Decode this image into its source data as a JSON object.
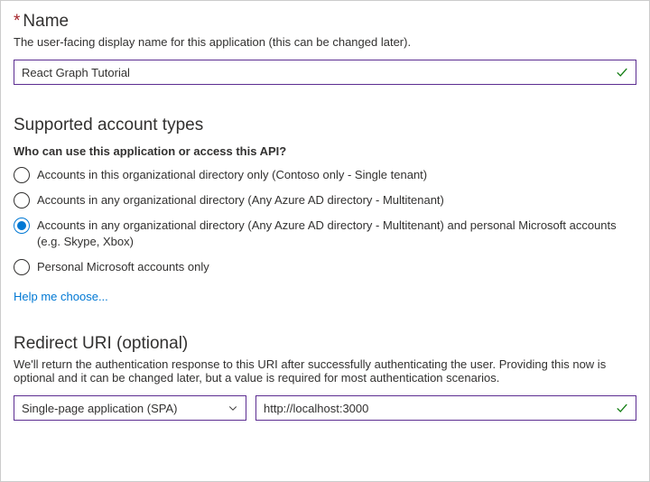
{
  "name_section": {
    "required_mark": "*",
    "title": "Name",
    "description": "The user-facing display name for this application (this can be changed later).",
    "value": "React Graph Tutorial"
  },
  "account_types_section": {
    "title": "Supported account types",
    "question": "Who can use this application or access this API?",
    "options": [
      "Accounts in this organizational directory only (Contoso only - Single tenant)",
      "Accounts in any organizational directory (Any Azure AD directory - Multitenant)",
      "Accounts in any organizational directory (Any Azure AD directory - Multitenant) and personal Microsoft accounts (e.g. Skype, Xbox)",
      "Personal Microsoft accounts only"
    ],
    "selected_index": 2,
    "help_link": "Help me choose..."
  },
  "redirect_section": {
    "title": "Redirect URI (optional)",
    "description": "We'll return the authentication response to this URI after successfully authenticating the user. Providing this now is optional and it can be changed later, but a value is required for most authentication scenarios.",
    "platform_selected": "Single-page application (SPA)",
    "uri_value": "http://localhost:3000"
  },
  "colors": {
    "accent": "#5c2d91",
    "link": "#0078d4",
    "success": "#107c10",
    "required": "#a4262c"
  }
}
